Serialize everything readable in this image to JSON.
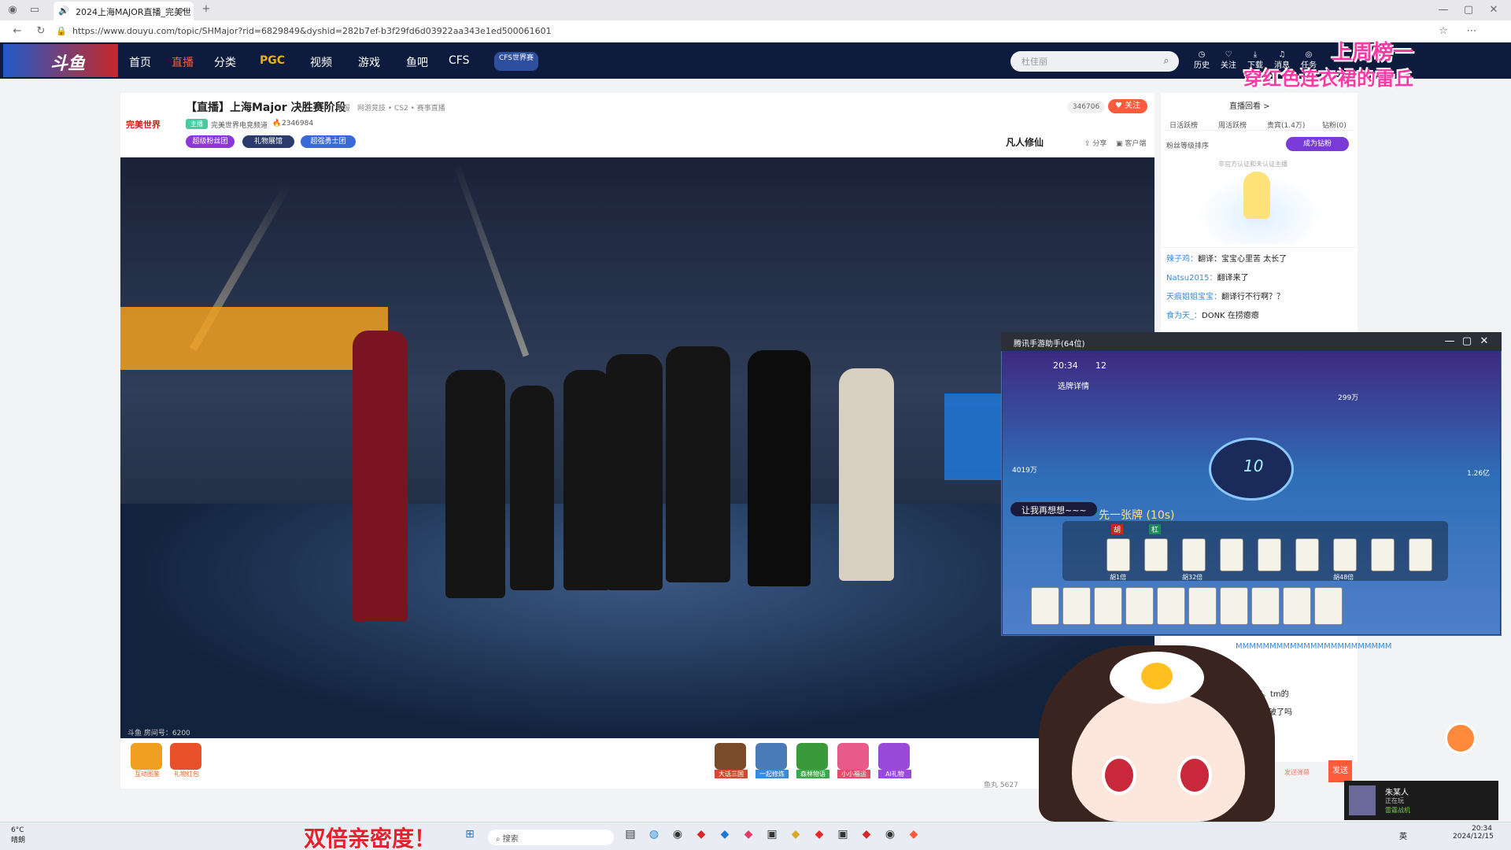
{
  "browser": {
    "tab_title": "2024上海MAJOR直播_完美世",
    "new_tab_icon": "+",
    "url": "https://www.douyu.com/topic/SHMajor?rid=6829849&dyshid=282b7ef-b3f29fd6d03922aa343e1ed500061601"
  },
  "nav": {
    "logo": "斗鱼",
    "links": [
      "首页",
      "直播",
      "分类",
      "PGC",
      "视频",
      "游戏",
      "鱼吧",
      "CFS"
    ],
    "cfs_badge": "CFS世界赛",
    "search_placeholder": "杜佳丽",
    "tools": [
      "历史",
      "关注",
      "下载",
      "消息",
      "任务",
      "开播"
    ]
  },
  "overlay": {
    "top_line": "上周榜一",
    "second_line": "穿红色连衣裙的雷丘",
    "bottom_text": "双倍亲密度！"
  },
  "room": {
    "title": "【直播】上海Major 决胜赛阶段",
    "report": "举报",
    "category": "网游竞技 • CS2 • 赛事直播",
    "brand": "完美世界",
    "anchor": "完美世界电竞频道",
    "hot": "2346984",
    "badge_tag": "主播",
    "fans_count": "346706",
    "follow": "关注",
    "pills": [
      "超级粉丝团",
      "礼物展馆",
      "超强勇士团"
    ],
    "sponsor": "凡人修仙",
    "share": "分享",
    "client": "客户端",
    "watermark": "斗鱼 房间号：6200",
    "fish_balls": "鱼丸 5627"
  },
  "gifts": [
    "互动图鉴",
    "礼物红包",
    "大话三国",
    "一起修炼",
    "森林物语",
    "小小福运",
    "AI礼物"
  ],
  "sidebar": {
    "replay": "直播回看 >",
    "tabs": [
      "日活跃榜",
      "周活跃榜",
      "贵宾(1.4万)",
      "钻粉(0)"
    ],
    "fan_rank": "粉丝等级排序",
    "grow": "成为钻粉",
    "hint": "非官方认证和未认证主播",
    "chat": [
      {
        "user": "辣子鸡：",
        "text": "翻译：宝宝心里苦 太长了"
      },
      {
        "user": "Natsu2015：",
        "text": "翻译来了"
      },
      {
        "user": "天痕姐姐宝宝：",
        "text": "翻译行不行啊？？"
      },
      {
        "user": "食为天_：",
        "text": "DONK 在捞瘪瘪"
      }
    ],
    "chat_lower": [
      "MMMMMMMMMMMMMMMMMMMMMMM",
      "又在编。tm的",
      "瘪瘪破了吗"
    ],
    "send": "发送",
    "note": "发送弹幕"
  },
  "mahjong": {
    "window_title": "腾讯手游助手(64位)",
    "time": "20:34",
    "count": "12",
    "detail": "选牌详情",
    "timer": "10",
    "hint_text": "让我再想想~~~",
    "play_text": "先一张牌 (10s)",
    "left_score": "4019万",
    "right_score": "1.26亿",
    "top_score": "299万",
    "hu_label": "胡",
    "gang_label": "杠",
    "bets": [
      "胡1倍",
      "胡32倍",
      "胡48倍"
    ]
  },
  "streamer_notice": {
    "name": "朱某人",
    "status": "正在玩",
    "game": "雷霆战机"
  },
  "taskbar": {
    "weather": "6°C",
    "weather_desc": "晴朗",
    "search": "搜索",
    "ime": "英",
    "time": "20:34",
    "date": "2024/12/15"
  }
}
